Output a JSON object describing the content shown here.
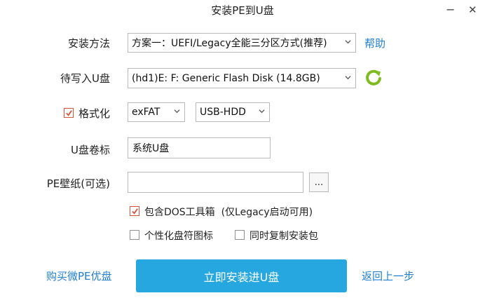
{
  "window": {
    "title": "安装PE到U盘",
    "minimize_glyph": "−",
    "close_glyph": "✕"
  },
  "form": {
    "install_method": {
      "label": "安装方法",
      "value": "方案一：UEFI/Legacy全能三分区方式(推荐)",
      "help_link": "帮助"
    },
    "target_disk": {
      "label": "待写入U盘",
      "value": "(hd1)E: F: Generic Flash Disk (14.8GB)",
      "refresh_icon": "refresh-icon",
      "refresh_color": "#7dbb1f"
    },
    "format": {
      "label": "格式化",
      "checked": true,
      "filesystem": "exFAT",
      "mode": "USB-HDD"
    },
    "volume_label": {
      "label": "U盘卷标",
      "value": "系统U盘"
    },
    "wallpaper": {
      "label": "PE壁纸(可选)",
      "value": "",
      "browse_label": "..."
    },
    "options": {
      "dos_tools": {
        "label": "包含DOS工具箱  (仅Legacy启动可用)",
        "checked": true
      },
      "personalize_icon": {
        "label": "个性化盘符图标",
        "checked": false
      },
      "copy_package": {
        "label": "同时复制安装包",
        "checked": false
      }
    }
  },
  "footer": {
    "buy_link": "购买微PE优盘",
    "install_button": "立即安装进U盘",
    "back_link": "返回上一步"
  },
  "colors": {
    "accent": "#26a7e0",
    "link": "#1f7fd0",
    "check": "#d9533b"
  }
}
